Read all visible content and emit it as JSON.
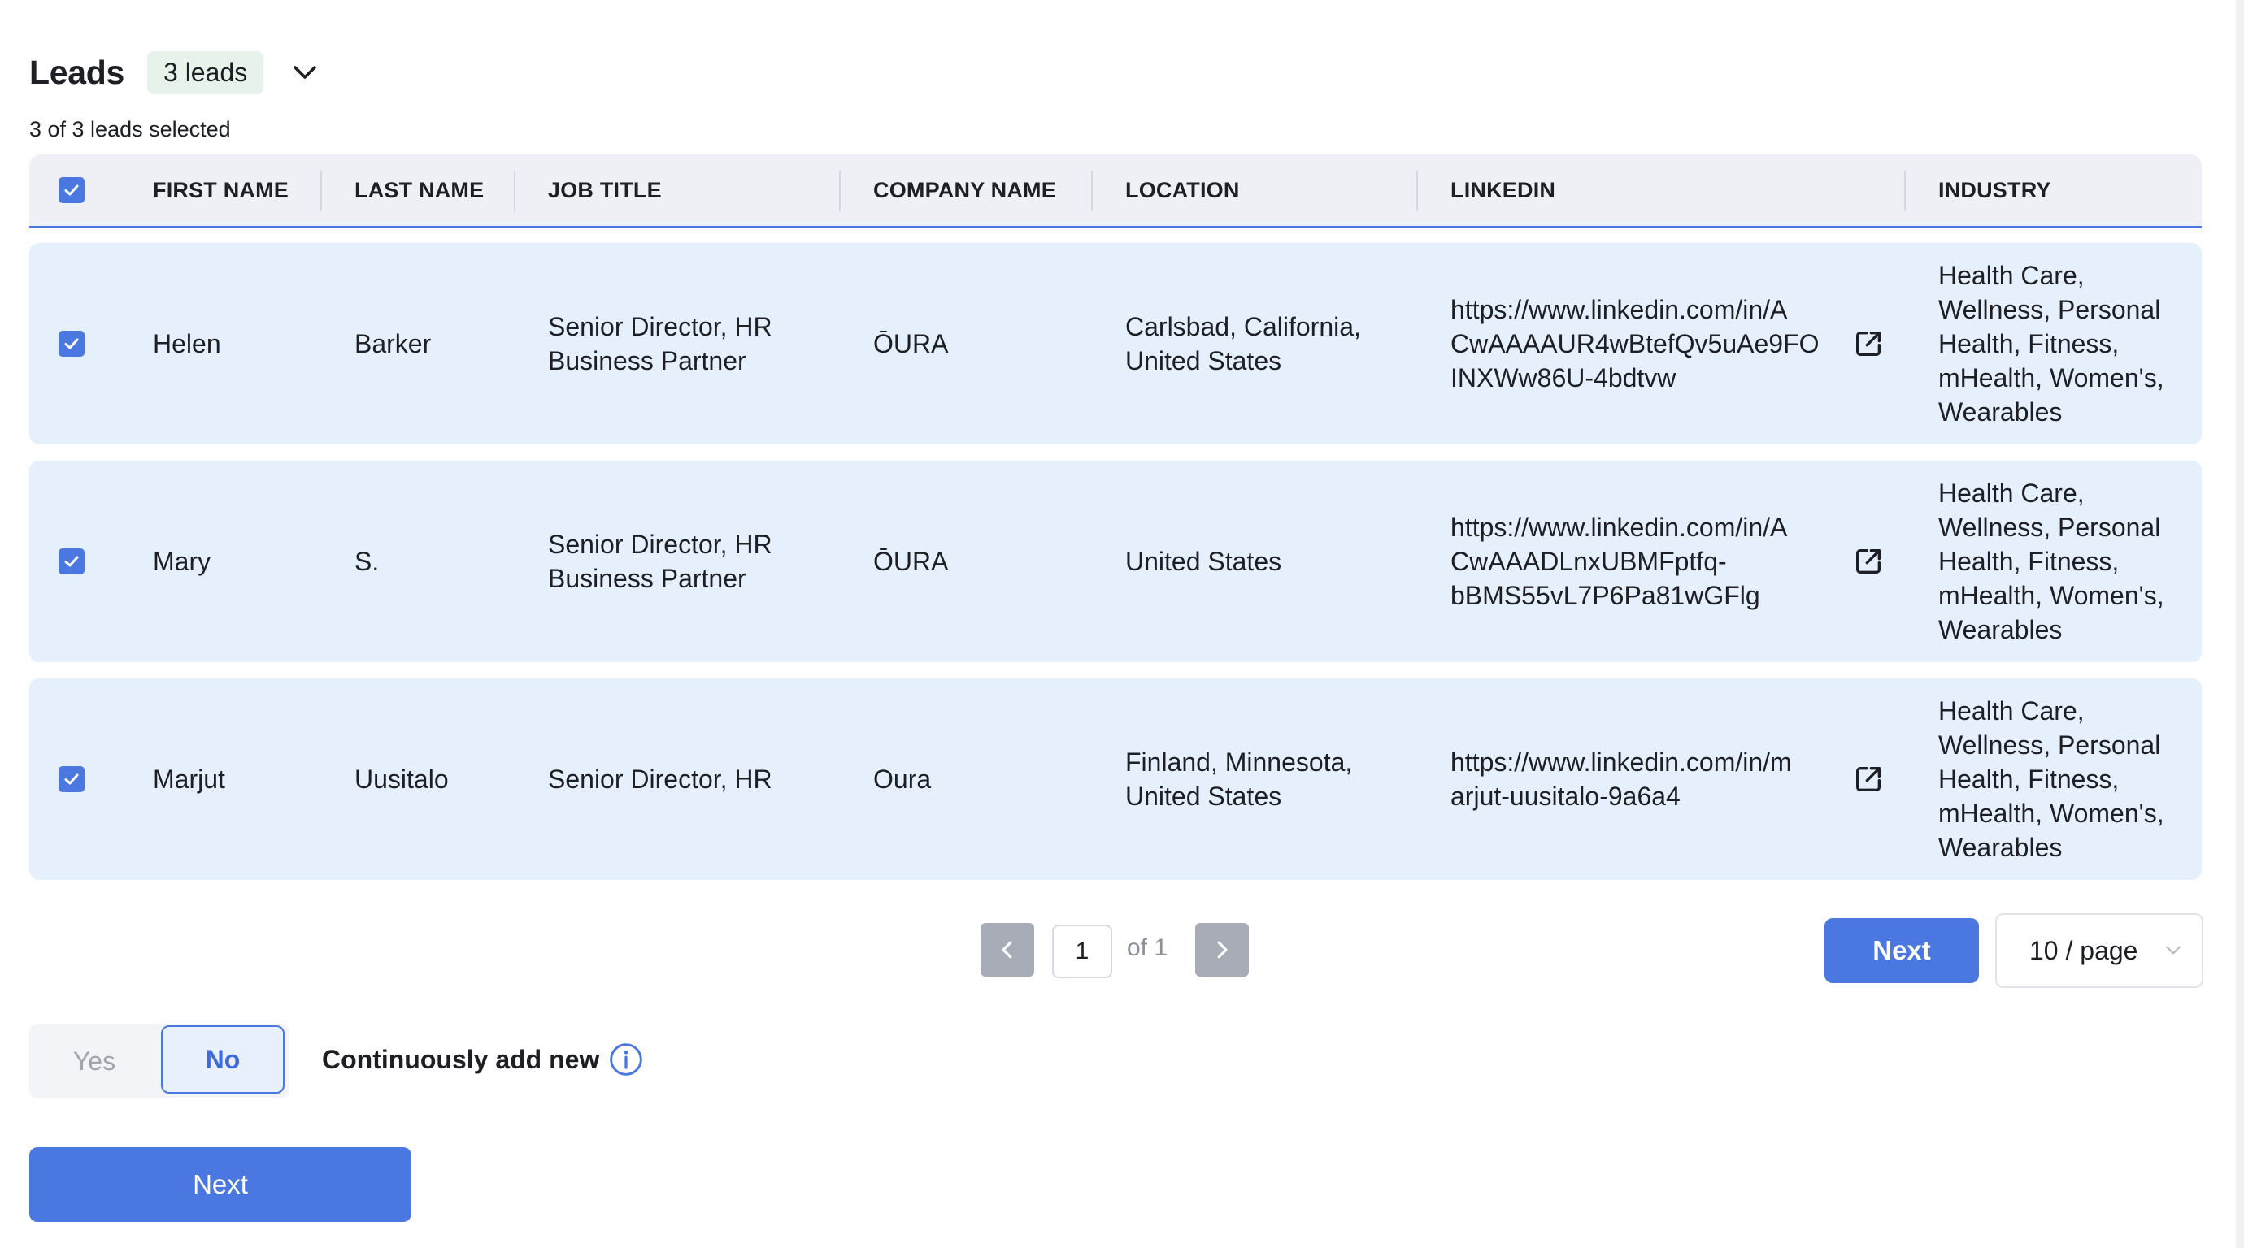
{
  "header": {
    "title": "Leads",
    "badge": "3 leads",
    "selected_text": "3 of 3 leads selected"
  },
  "table": {
    "columns": [
      "FIRST NAME",
      "LAST NAME",
      "JOB TITLE",
      "COMPANY NAME",
      "LOCATION",
      "LINKEDIN",
      "INDUSTRY"
    ],
    "all_selected": true,
    "rows": [
      {
        "selected": true,
        "first_name": "Helen",
        "last_name": "Barker",
        "job_title": [
          "Senior Director, HR",
          "Business Partner"
        ],
        "company": "ŌURA",
        "location": [
          "Carlsbad, California,",
          "United States"
        ],
        "linkedin": [
          "https://www.linkedin.com/in/A",
          "CwAAAAUR4wBtefQv5uAe9FO",
          "INXWw86U-4bdtvw"
        ],
        "industry": [
          "Health Care,",
          "Wellness, Personal",
          "Health, Fitness,",
          "mHealth, Women's,",
          "Wearables"
        ]
      },
      {
        "selected": true,
        "first_name": "Mary",
        "last_name": "S.",
        "job_title": [
          "Senior Director, HR",
          "Business Partner"
        ],
        "company": "ŌURA",
        "location": [
          "United States"
        ],
        "linkedin": [
          "https://www.linkedin.com/in/A",
          "CwAAADLnxUBMFptfq-",
          "bBMS55vL7P6Pa81wGFlg"
        ],
        "industry": [
          "Health Care,",
          "Wellness, Personal",
          "Health, Fitness,",
          "mHealth, Women's,",
          "Wearables"
        ]
      },
      {
        "selected": true,
        "first_name": "Marjut",
        "last_name": "Uusitalo",
        "job_title": [
          "Senior Director, HR"
        ],
        "company": "Oura",
        "location": [
          "Finland, Minnesota,",
          "United States"
        ],
        "linkedin": [
          "https://www.linkedin.com/in/m",
          "arjut-uusitalo-9a6a4"
        ],
        "industry": [
          "Health Care,",
          "Wellness, Personal",
          "Health, Fitness,",
          "mHealth, Women's,",
          "Wearables"
        ]
      }
    ]
  },
  "pagination": {
    "current_page": "1",
    "of_label": "of 1",
    "next_label": "Next",
    "page_size": "10 / page"
  },
  "toggle": {
    "yes_label": "Yes",
    "no_label": "No",
    "selected": "No"
  },
  "continuous_label": "Continuously add new",
  "footer": {
    "next_label": "Next"
  },
  "colors": {
    "accent": "#4a77e0",
    "row_bg": "#e6f0fc",
    "header_bg": "#eef0f5",
    "badge_bg": "#e7f3ea"
  },
  "icons": {
    "header_toggle": "chevron-down-icon",
    "row_link": "external-link-icon",
    "info": "info-circle-icon",
    "prev": "chevron-left-icon",
    "next": "chevron-right-icon",
    "select_caret": "chevron-down-icon"
  }
}
